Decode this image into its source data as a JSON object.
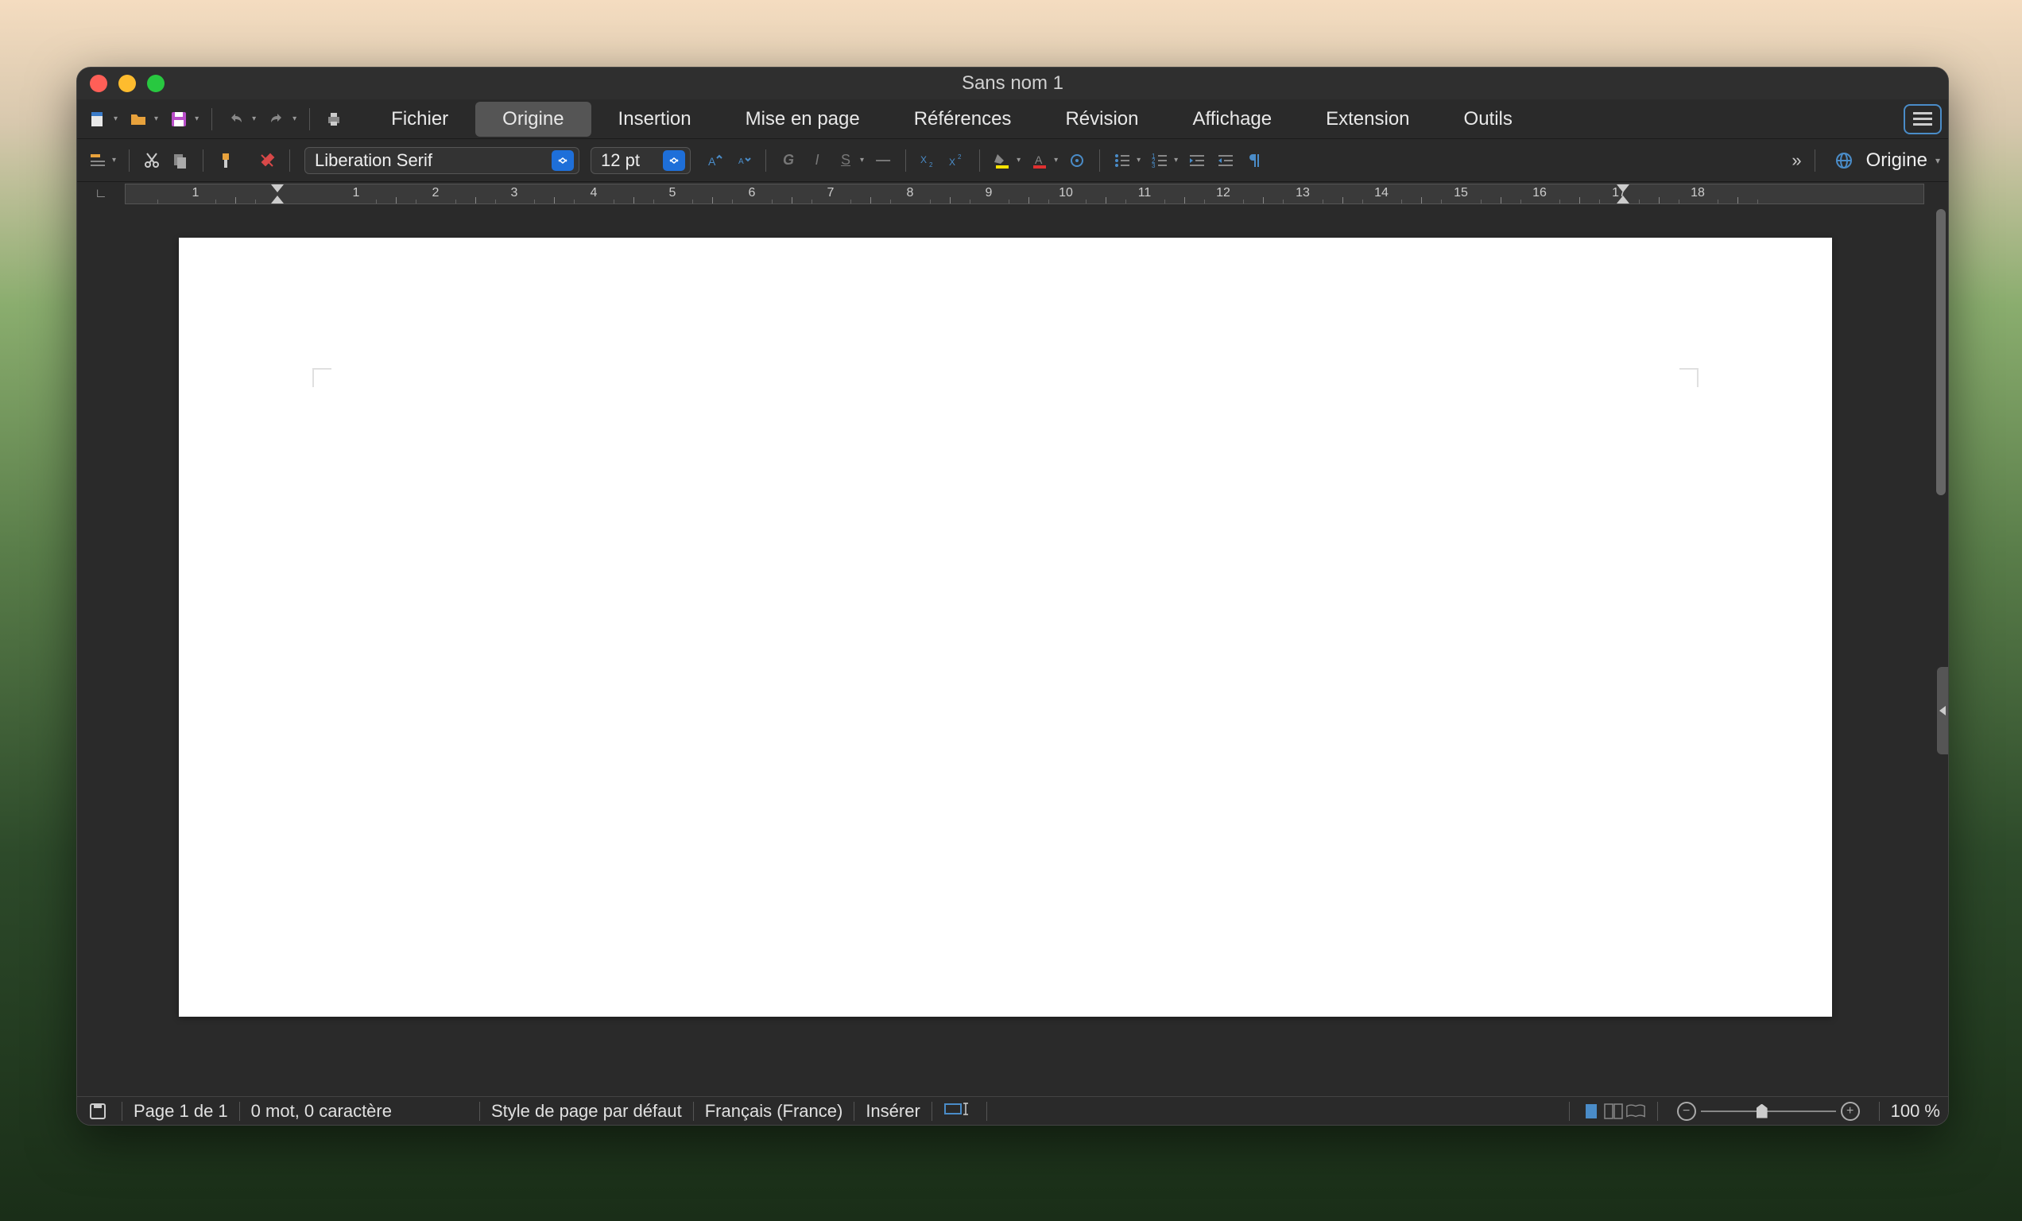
{
  "window": {
    "title": "Sans nom 1"
  },
  "menu": {
    "tabs": [
      "Fichier",
      "Origine",
      "Insertion",
      "Mise en page",
      "Références",
      "Révision",
      "Affichage",
      "Extension",
      "Outils"
    ],
    "active_index": 1
  },
  "toolbar": {
    "font_name": "Liberation Serif",
    "font_size": "12 pt",
    "origin_label": "Origine"
  },
  "ruler": {
    "numbers": [
      1,
      1,
      2,
      3,
      4,
      5,
      6,
      7,
      8,
      9,
      10,
      11,
      12,
      13,
      14,
      15,
      16,
      17,
      18
    ]
  },
  "statusbar": {
    "page": "Page 1 de 1",
    "words": "0 mot, 0 caractère",
    "page_style": "Style de page par défaut",
    "language": "Français (France)",
    "insert_mode": "Insérer",
    "zoom": "100 %"
  }
}
